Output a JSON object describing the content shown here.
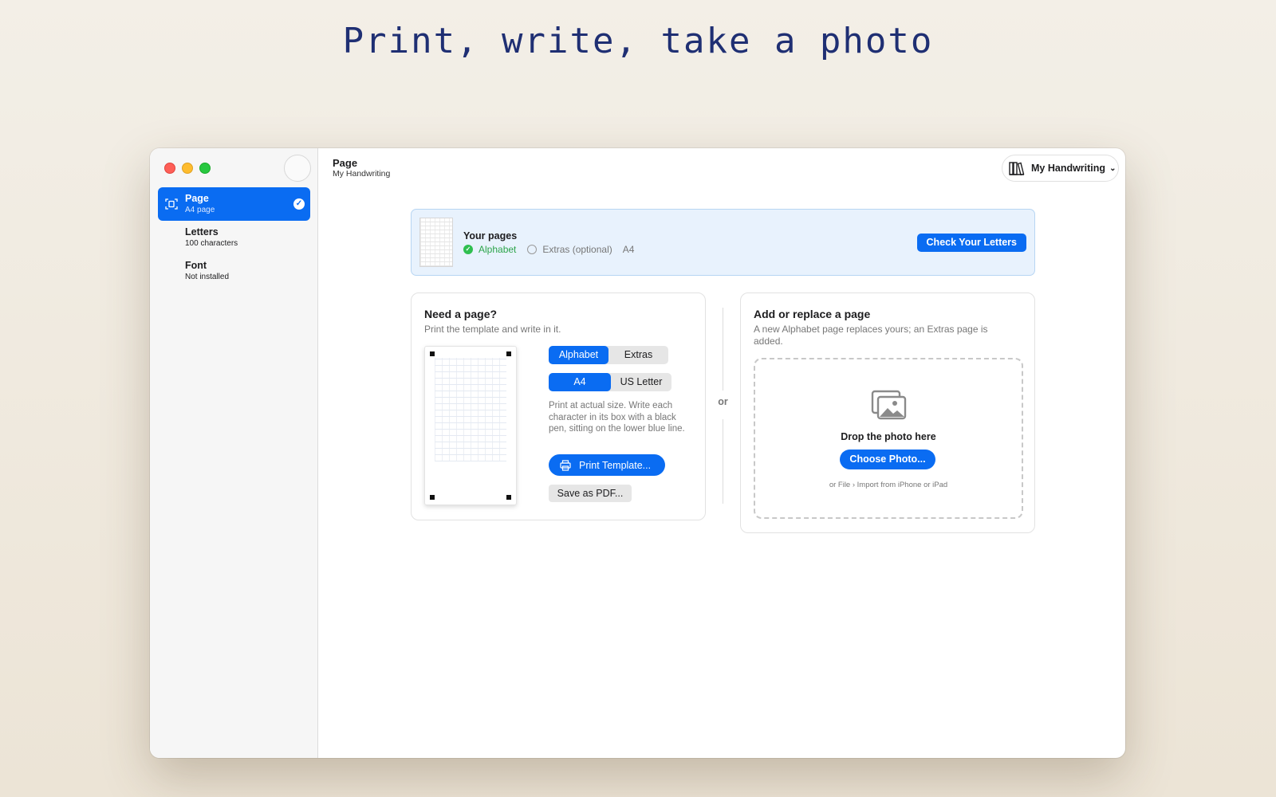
{
  "headline": "Print, write, take a photo",
  "colors": {
    "accent": "#0a6cf2",
    "success": "#2fbf50",
    "headline": "#1f2f73"
  },
  "sidebar": {
    "items": [
      {
        "title": "Page",
        "subtitle": "A4 page",
        "icon": "page-scan-icon",
        "active": true,
        "checked": true
      },
      {
        "title": "Letters",
        "subtitle": "100 characters"
      },
      {
        "title": "Font",
        "subtitle": "Not installed"
      }
    ]
  },
  "titlebar": {
    "title": "Page",
    "subtitle": "My Handwriting",
    "document_menu": {
      "label": "My Handwriting",
      "icon": "library-icon"
    }
  },
  "banner": {
    "title": "Your pages",
    "alphabet_status": "Alphabet",
    "extras_status": "Extras (optional)",
    "paper_size": "A4",
    "check_button": "Check Your Letters"
  },
  "need_page": {
    "title": "Need a page?",
    "description": "Print the template and write in it.",
    "page_type_options": [
      "Alphabet",
      "Extras"
    ],
    "page_type_selected": "Alphabet",
    "paper_options": [
      "A4",
      "US Letter"
    ],
    "paper_selected": "A4",
    "instructions": "Print at actual size. Write each character in its box with a black pen, sitting on the lower blue line.",
    "print_button": "Print Template...",
    "pdf_button": "Save as PDF..."
  },
  "separator": "or",
  "add_page": {
    "title": "Add or replace a page",
    "description": "A new Alphabet page replaces yours; an Extras page is added.",
    "drop_title": "Drop the photo here",
    "choose_button": "Choose Photo...",
    "hint": "or File › Import from iPhone or iPad"
  }
}
